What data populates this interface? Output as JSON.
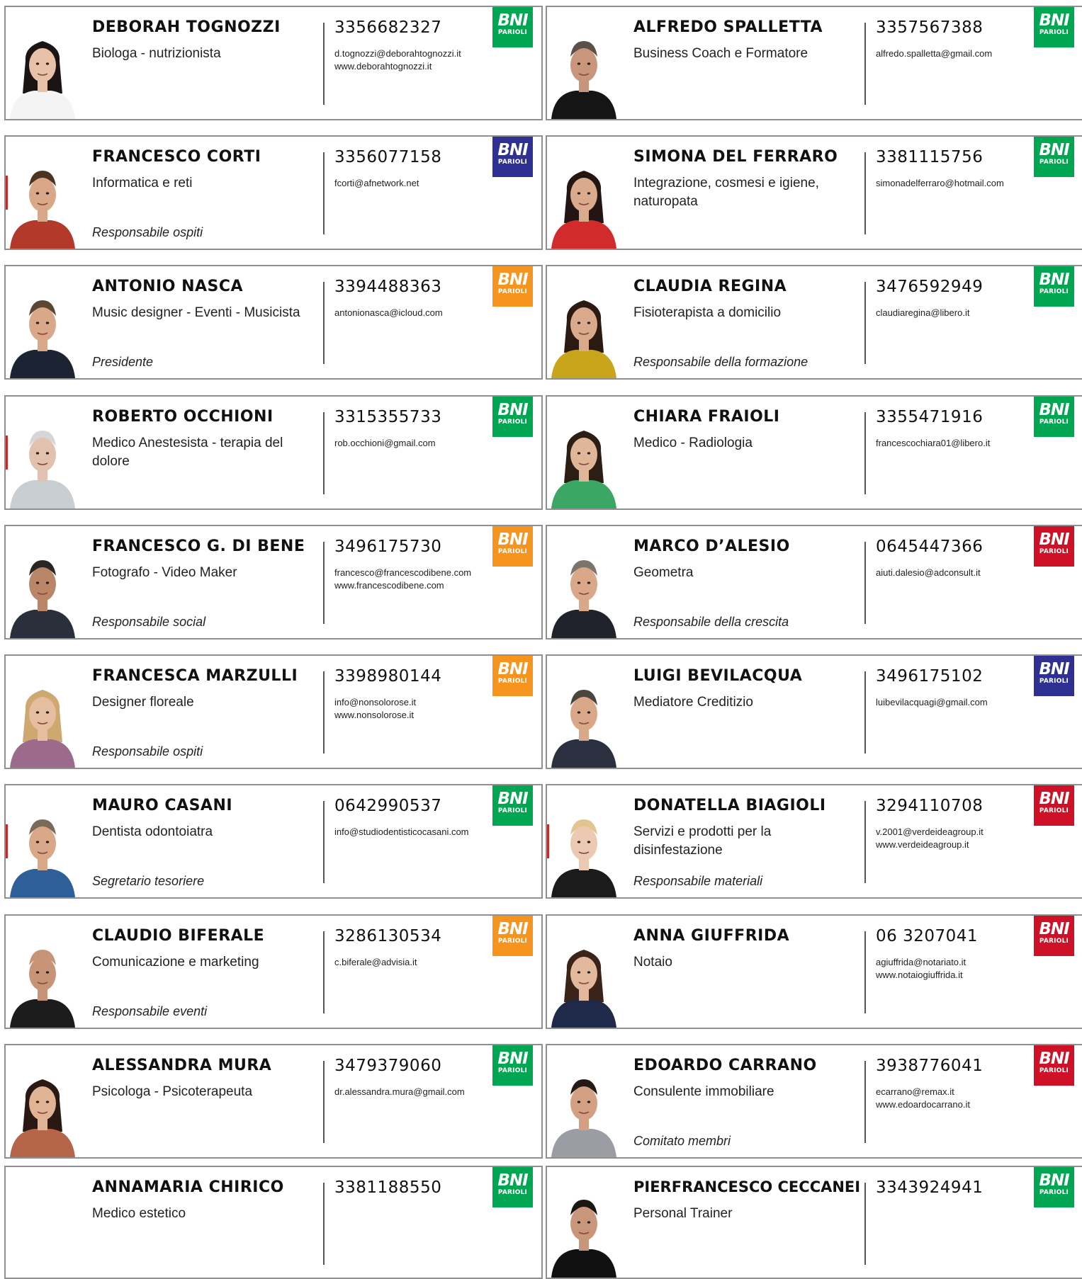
{
  "colors": {
    "green": "#00a651",
    "orange": "#f7941d",
    "blue": "#2e3192",
    "red": "#ce1126"
  },
  "members": [
    {
      "name": "DEBORAH TOGNOZZI",
      "profession": "Biologa - nutrizionista",
      "role": "",
      "phone": "3356682327",
      "contacts": [
        "d.tognozzi@deborahtognozzi.it",
        "www.deborahtognozzi.it"
      ],
      "logo_color": "green",
      "photo": "woman-dark-hair",
      "logo_top": "BNI",
      "logo_sub": "PARIOLI"
    },
    {
      "name": "ALFREDO SPALLETTA",
      "profession": "Business Coach e Formatore",
      "role": "",
      "phone": "3357567388",
      "contacts": [
        "alfredo.spalletta@gmail.com"
      ],
      "logo_color": "green",
      "photo": "man-black-shirt",
      "logo_top": "BNI",
      "logo_sub": "PARIOLI"
    },
    {
      "name": "FRANCESCO CORTI",
      "profession": "Informatica e reti",
      "role": "Responsabile ospiti",
      "phone": "3356077158",
      "contacts": [
        "fcorti@afnetwork.net"
      ],
      "logo_color": "blue",
      "photo": "man-beard",
      "logo_top": "BNI",
      "logo_sub": "PARIOLI"
    },
    {
      "name": "SIMONA DEL FERRARO",
      "profession": "Integrazione, cosmesi e igiene, naturopata",
      "role": "",
      "phone": "3381115756",
      "contacts": [
        "simonadelferraro@hotmail.com"
      ],
      "logo_color": "green",
      "photo": "woman-red-top",
      "logo_top": "BNI",
      "logo_sub": "PARIOLI"
    },
    {
      "name": "ANTONIO NASCA",
      "profession": "Music designer - Eventi - Musicista",
      "role": "Presidente",
      "phone": "3394488363",
      "contacts": [
        "antonionasca@icloud.com"
      ],
      "logo_color": "orange",
      "photo": "man-suit",
      "logo_top": "BNI",
      "logo_sub": "PARIOLI"
    },
    {
      "name": "CLAUDIA REGINA",
      "profession": "Fisioterapista a domicilio",
      "role": "Responsabile della formazione",
      "phone": "3476592949",
      "contacts": [
        "claudiaregina@libero.it"
      ],
      "logo_color": "green",
      "photo": "woman-yellow-top",
      "logo_top": "BNI",
      "logo_sub": "PARIOLI"
    },
    {
      "name": "ROBERTO OCCHIONI",
      "profession": "Medico Anestesista - terapia del dolore",
      "role": "",
      "phone": "3315355733",
      "contacts": [
        "rob.occhioni@gmail.com"
      ],
      "logo_color": "green",
      "photo": "man-grey-hair",
      "logo_top": "BNI",
      "logo_sub": "PARIOLI"
    },
    {
      "name": "CHIARA FRAIOLI",
      "profession": "Medico - Radiologia",
      "role": "",
      "phone": "3355471916",
      "contacts": [
        "francescochiara01@libero.it"
      ],
      "logo_color": "green",
      "photo": "woman-green-scarf",
      "logo_top": "BNI",
      "logo_sub": "PARIOLI"
    },
    {
      "name": "FRANCESCO G. DI BENE",
      "profession": "Fotografo - Video Maker",
      "role": "Responsabile social",
      "phone": "3496175730",
      "contacts": [
        "francesco@francescodibene.com",
        "www.francescodibene.com"
      ],
      "logo_color": "orange",
      "photo": "man-dark-shirt",
      "logo_top": "BNI",
      "logo_sub": "PARIOLI"
    },
    {
      "name": "MARCO D’ALESIO",
      "profession": "Geometra",
      "role": "Responsabile della crescita",
      "phone": "0645447366",
      "contacts": [
        "aiuti.dalesio@adconsult.it"
      ],
      "logo_color": "red",
      "photo": "man-tie",
      "logo_top": "BNI",
      "logo_sub": "PARIOLI"
    },
    {
      "name": "FRANCESCA MARZULLI",
      "profession": "Designer  floreale",
      "role": "Responsabile ospiti",
      "phone": "3398980144",
      "contacts": [
        "info@nonsolorose.it",
        "www.nonsolorose.it"
      ],
      "logo_color": "orange",
      "photo": "woman-blonde",
      "logo_top": "BNI",
      "logo_sub": "PARIOLI"
    },
    {
      "name": "LUIGI BEVILACQUA",
      "profession": "Mediatore Creditizio",
      "role": "",
      "phone": "3496175102",
      "contacts": [
        "luibevilacquagi@gmail.com"
      ],
      "logo_color": "blue",
      "photo": "man-glasses-suit",
      "logo_top": "BNI",
      "logo_sub": "PARIOLI"
    },
    {
      "name": "MAURO CASANI",
      "profession": "Dentista odontoiatra",
      "role": "Segretario tesoriere",
      "phone": "0642990537",
      "contacts": [
        "info@studiodentisticocasani.com"
      ],
      "logo_color": "green",
      "photo": "man-blue-shirt",
      "logo_top": "BNI",
      "logo_sub": "PARIOLI"
    },
    {
      "name": "DONATELLA BIAGIOLI",
      "profession": "Servizi e prodotti per la disinfestazione",
      "role": "Responsabile materiali",
      "phone": "3294110708",
      "contacts": [
        "v.2001@verdeideagroup.it",
        "www.verdeideagroup.it"
      ],
      "logo_color": "red",
      "photo": "woman-short-blonde",
      "logo_top": "BNI",
      "logo_sub": "PARIOLI"
    },
    {
      "name": "CLAUDIO BIFERALE",
      "profession": "Comunicazione e marketing",
      "role": "Responsabile eventi",
      "phone": "3286130534",
      "contacts": [
        "c.biferale@advisia.it"
      ],
      "logo_color": "orange",
      "photo": "man-bald-glasses",
      "logo_top": "BNI",
      "logo_sub": "PARIOLI"
    },
    {
      "name": "ANNA GIUFFRIDA",
      "profession": "Notaio",
      "role": "",
      "phone": "06 3207041",
      "contacts": [
        "agiuffrida@notariato.it",
        "www.notaiogiuffrida.it"
      ],
      "logo_color": "red",
      "photo": "woman-navy-dress",
      "logo_top": "BNI",
      "logo_sub": "PARIOLI"
    },
    {
      "name": "ALESSANDRA MURA",
      "profession": "Psicologa - Psicoterapeuta",
      "role": "",
      "phone": "3479379060",
      "contacts": [
        "dr.alessandra.mura@gmail.com"
      ],
      "logo_color": "green",
      "photo": "woman-patterned-top",
      "logo_top": "BNI",
      "logo_sub": "PARIOLI"
    },
    {
      "name": "EDOARDO CARRANO",
      "profession": "Consulente immobiliare",
      "role": "Comitato membri",
      "phone": "3938776041",
      "contacts": [
        "ecarrano@remax.it",
        "www.edoardocarrano.it"
      ],
      "logo_color": "red",
      "photo": "man-grey-blazer",
      "logo_top": "BNI",
      "logo_sub": "PARIOLI"
    },
    {
      "name": "ANNAMARIA CHIRICO",
      "profession": "Medico estetico",
      "role": "",
      "phone": "3381188550",
      "contacts": [],
      "logo_color": "green",
      "photo": "",
      "logo_top": "BNI",
      "logo_sub": "PARIOLI"
    },
    {
      "name": "PIERFRANCESCO CECCANEI",
      "profession": "Personal Trainer",
      "role": "",
      "phone": "3343924941",
      "contacts": [],
      "logo_color": "green",
      "photo": "man-black-tshirt",
      "logo_top": "BNI",
      "logo_sub": "PARIOLI"
    }
  ]
}
